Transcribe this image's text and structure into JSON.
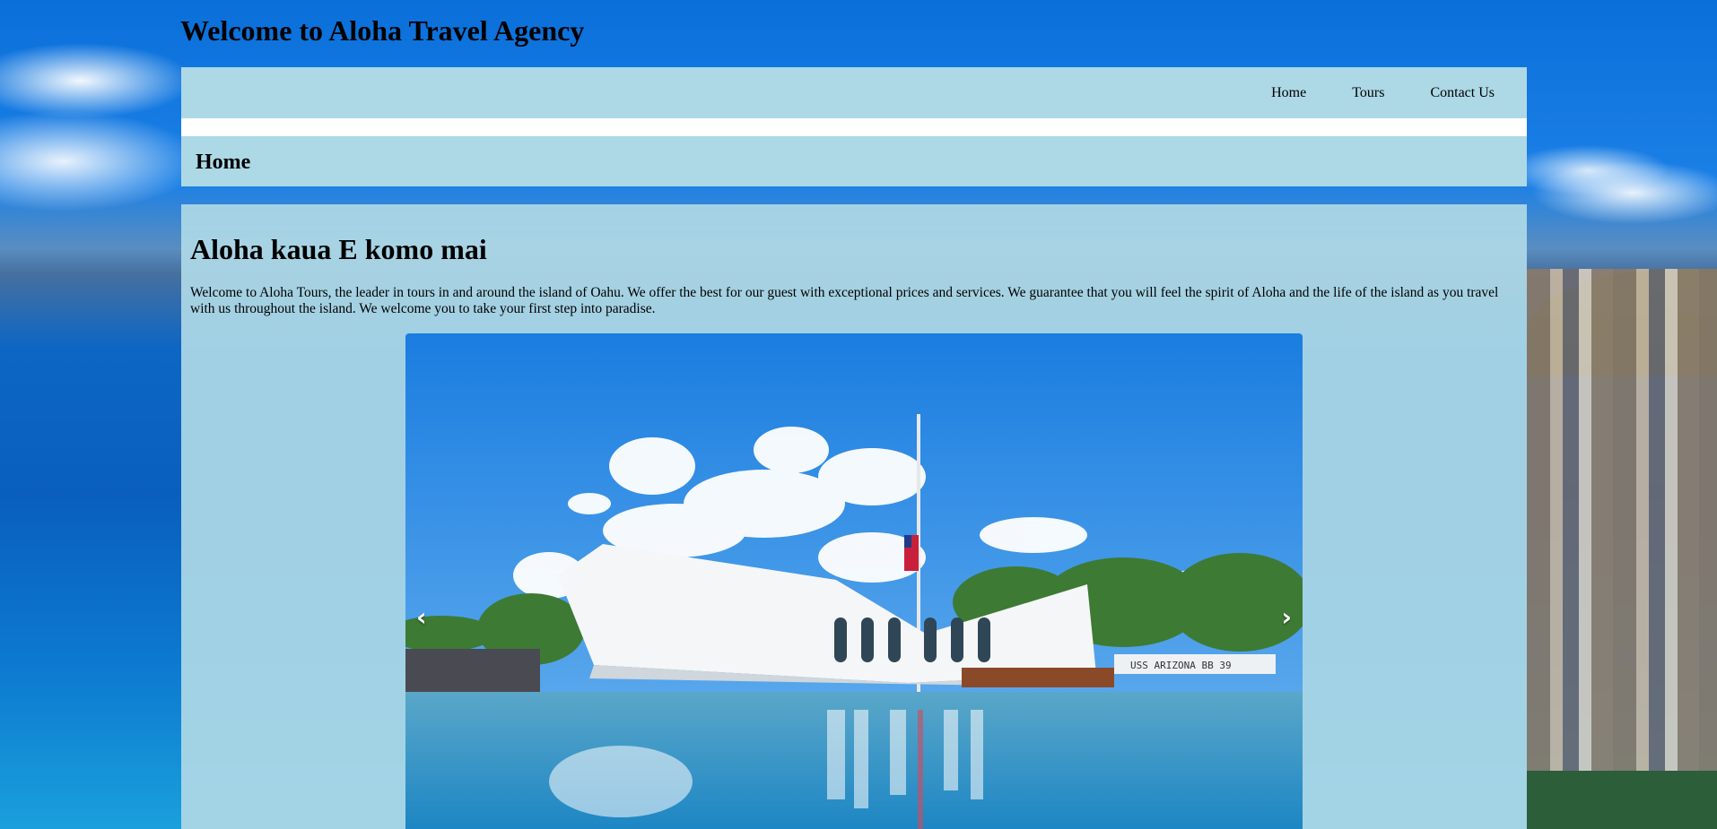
{
  "site": {
    "title": "Welcome to Aloha Travel Agency"
  },
  "nav": {
    "items": [
      {
        "label": "Home"
      },
      {
        "label": "Tours"
      },
      {
        "label": "Contact Us"
      }
    ]
  },
  "page": {
    "header": "Home"
  },
  "main": {
    "heading": "Aloha kaua E komo mai",
    "intro": "Welcome to Aloha Tours, the leader in tours in and around the island of Oahu. We offer the best for our guest with exceptional prices and services. We guarantee that you will feel the spirit of Aloha and the life of the island as you travel with us throughout the island. We welcome you to take your first step into paradise."
  },
  "carousel": {
    "prev_glyph": "‹",
    "next_glyph": "›",
    "slide_sign_text": "USS ARIZONA BB 39"
  },
  "colors": {
    "panel": "#add8e6",
    "nav_strip": "#ffffff"
  }
}
